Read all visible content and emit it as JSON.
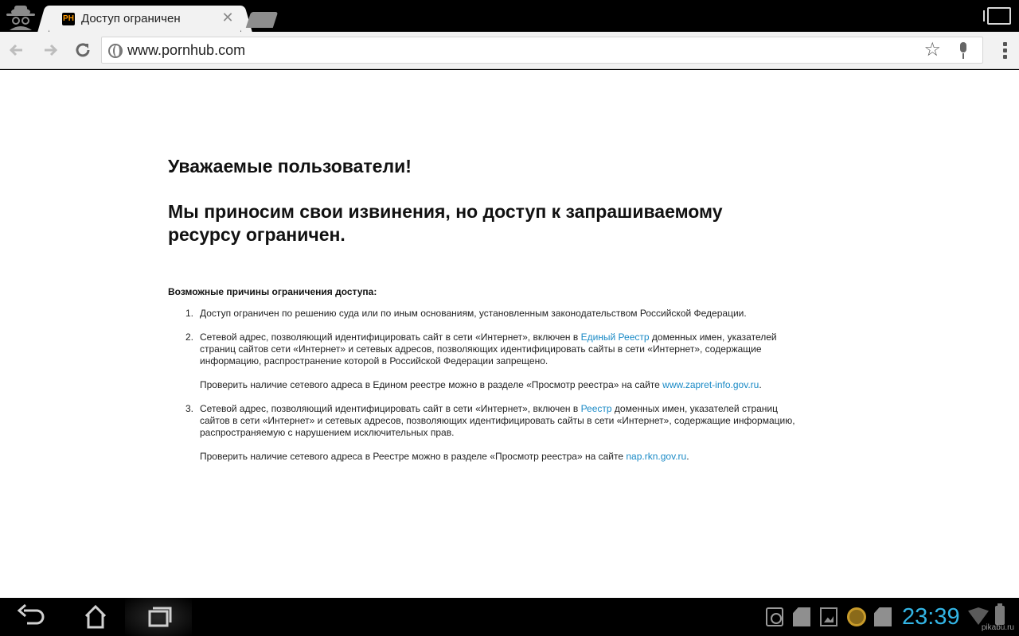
{
  "browser": {
    "tab": {
      "favicon_text": "PH",
      "title": "Доступ ограничен",
      "close_glyph": "✕"
    },
    "address_bar": {
      "url": "www.pornhub.com"
    },
    "icons": {
      "incognito": "incognito-icon",
      "back": "back-arrow-icon",
      "forward": "forward-arrow-icon",
      "reload": "reload-icon",
      "site": "globe-icon",
      "bookmark": "star-icon",
      "voice": "mic-icon",
      "menu": "overflow-menu-icon",
      "tab_switcher": "tab-switcher-icon"
    }
  },
  "page": {
    "heading": "Уважаемые пользователи!",
    "subheading": "Мы приносим свои извинения, но доступ к запрашиваемому ресурсу ограничен.",
    "reasons_title": "Возможные причины ограничения доступа:",
    "reasons": [
      {
        "number": "1.",
        "text": "Доступ ограничен  по решению суда или по иным основаниям, установленным законодательством Российской Федерации."
      },
      {
        "number": "2.",
        "text_before": "Сетевой адрес, позволяющий идентифицировать сайт в сети «Интернет», включен в ",
        "link": "Единый Реестр",
        "text_after": " доменных имен, указателей страниц сайтов сети «Интернет» и сетевых адресов, позволяющих идентифицировать сайты в сети «Интернет», содержащие информацию, распространение которой в Российской Федерации запрещено.",
        "check_before": "Проверить наличие сетевого адреса в Едином реестре можно в разделе «Просмотр реестра» на сайте ",
        "check_link": "www.zapret-info.gov.ru",
        "check_after": "."
      },
      {
        "number": "3.",
        "text_before": "Сетевой адрес, позволяющий идентифицировать сайт в сети «Интернет», включен в ",
        "link": "Реестр",
        "text_after": " доменных имен, указателей страниц сайтов в сети «Интернет» и сетевых адресов, позволяющих идентифицировать сайты в сети «Интернет», содержащие информацию, распространяемую с нарушением исключительных прав.",
        "check_before": "Проверить наличие сетевого адреса в Реестре можно в разделе «Просмотр реестра» на сайте ",
        "check_link": "nap.rkn.gov.ru",
        "check_after": "."
      }
    ],
    "link_color": "#1a8ac6"
  },
  "system_bar": {
    "clock": "23:39",
    "clock_color": "#33b5e5",
    "watermark": "pikabu.ru"
  }
}
